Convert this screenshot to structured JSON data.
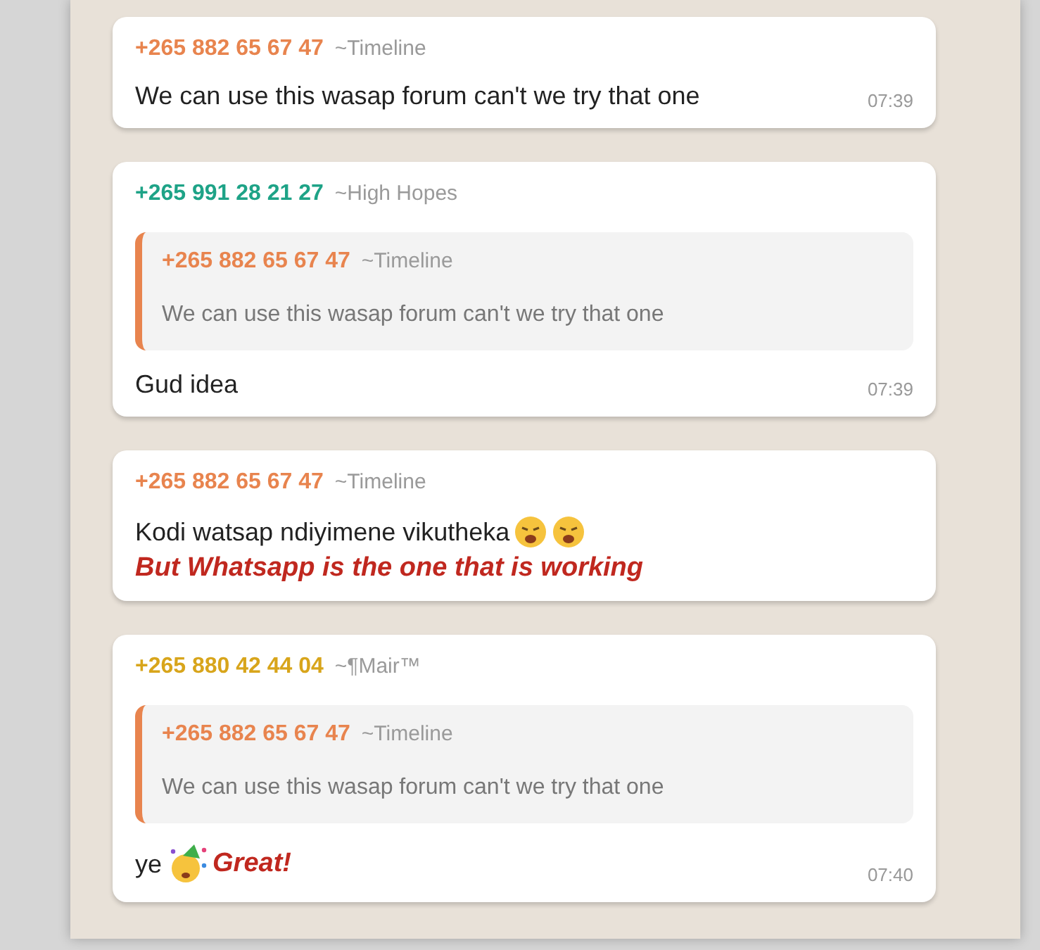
{
  "messages": [
    {
      "sender": "+265 882 65 67 47",
      "color": "#e8844e",
      "alias": "~Timeline",
      "parts": [
        {
          "kind": "text",
          "text": "We can use this wasap forum can't we try that one"
        }
      ],
      "time": "07:39"
    },
    {
      "sender": "+265 991 28 21 27",
      "color": "#1ea387",
      "alias": "~High Hopes",
      "quote": {
        "sender": "+265 882 65 67 47",
        "color": "#e8844e",
        "alias": "~Timeline",
        "text": "We can use this wasap forum can't we try that one"
      },
      "parts": [
        {
          "kind": "text",
          "text": "Gud idea"
        }
      ],
      "time": "07:39"
    },
    {
      "sender": "+265 882 65 67 47",
      "color": "#e8844e",
      "alias": "~Timeline",
      "parts": [
        {
          "kind": "text",
          "text": "Kodi watsap ndiyimene vikutheka"
        },
        {
          "kind": "tired"
        },
        {
          "kind": "tired"
        }
      ],
      "annotation": "But Whatsapp is the one that is working"
    },
    {
      "sender": "+265 880 42 44 04",
      "color": "#d8a51b",
      "alias": "~¶Mair™",
      "quote": {
        "sender": "+265 882 65 67 47",
        "color": "#e8844e",
        "alias": "~Timeline",
        "text": "We can use this wasap forum can't we try that one"
      },
      "parts": [
        {
          "kind": "text",
          "text": "ye"
        },
        {
          "kind": "party"
        }
      ],
      "annotation": "Great!",
      "time": "07:40"
    }
  ]
}
